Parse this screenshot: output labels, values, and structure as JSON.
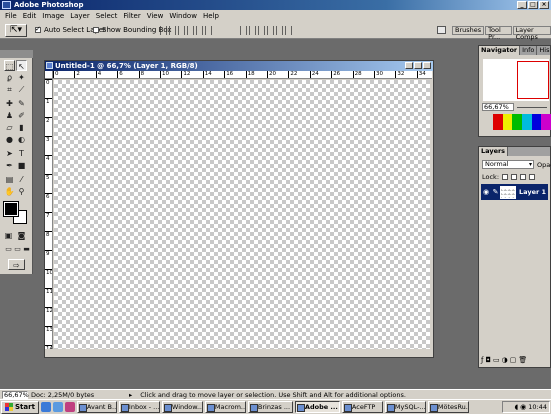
{
  "app": {
    "title": "Adobe Photoshop"
  },
  "menu": [
    "File",
    "Edit",
    "Image",
    "Layer",
    "Select",
    "Filter",
    "View",
    "Window",
    "Help"
  ],
  "options": {
    "auto_select_label": "Auto Select Layer",
    "show_bbox_label": "Show Bounding Box",
    "palette_tabs": [
      "Brushes",
      "Tool Pr...",
      "Layer Comps"
    ]
  },
  "document": {
    "title": "Untitled-1 @ 66,7% (Layer 1, RGB/8)",
    "ruler_h": [
      "0",
      "2",
      "4",
      "6",
      "8",
      "10",
      "12",
      "14",
      "16",
      "18",
      "20",
      "22",
      "24",
      "26",
      "28",
      "30",
      "32",
      "34"
    ],
    "ruler_v": [
      "0",
      "1",
      "2",
      "3",
      "4",
      "5",
      "6",
      "7",
      "8",
      "9",
      "10",
      "11",
      "12",
      "13",
      "14"
    ]
  },
  "navigator": {
    "tabs": [
      "Navigator",
      "Info",
      "His"
    ],
    "zoom": "66,67%"
  },
  "layers_panel": {
    "tab": "Layers",
    "blend_mode": "Normal",
    "opacity_label": "Opac",
    "lock_label": "Lock:",
    "layer_name": "Layer 1"
  },
  "status": {
    "zoom": "66,67%",
    "doc_info": "Doc: 2,25M/0 bytes",
    "hint": "Click and drag to move layer or selection.  Use Shift and Alt for additional options."
  },
  "taskbar": {
    "start": "Start",
    "tasks": [
      "Avant B...",
      "Inbox - ...",
      "Window...",
      "Macrom...",
      "Brinzas ...",
      "Adobe ...",
      "AceFTP",
      "MySQL-...",
      "MötesRu..."
    ],
    "active_task": "Adobe ...",
    "clock": "10:44"
  },
  "colors": {
    "title_blue": "#0a246a",
    "face": "#d4d0c8",
    "workspace": "#6b6b6b"
  },
  "icons": [
    "photoshop-icon",
    "move-tool-icon",
    "start-windows-icon",
    "speaker-icon"
  ]
}
